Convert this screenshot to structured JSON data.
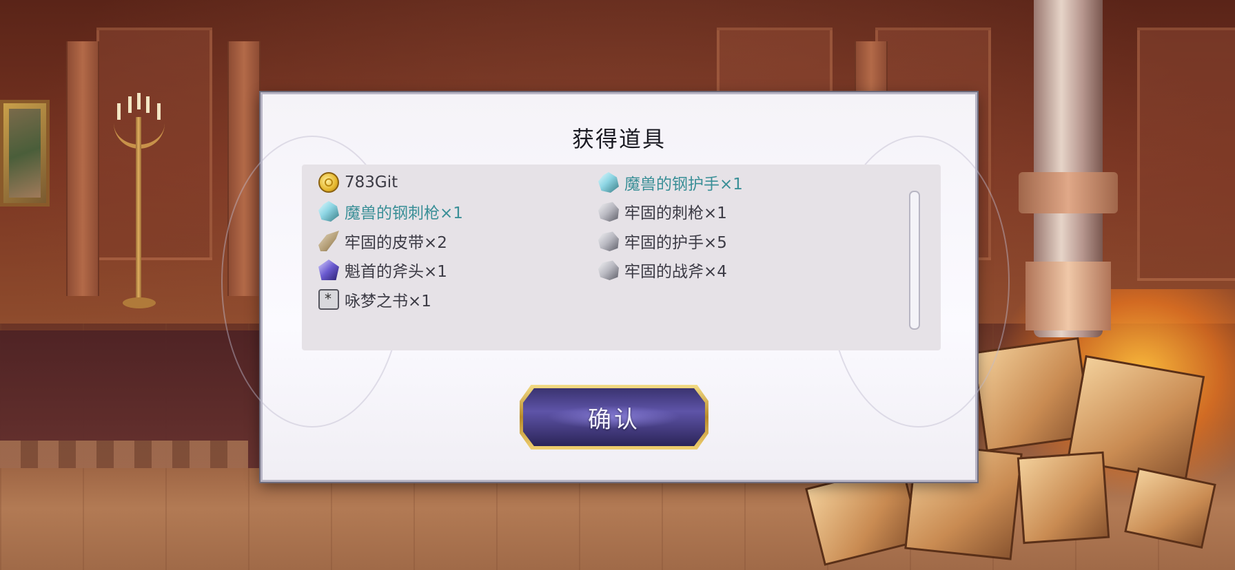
{
  "dialog": {
    "title": "获得道具",
    "confirm_label": "确认"
  },
  "items_left": [
    {
      "label": "783Git",
      "icon": "gold-coin-icon",
      "rare": false
    },
    {
      "label": "魔兽的钢刺枪×1",
      "icon": "crystal-icon",
      "rare": true
    },
    {
      "label": "牢固的皮带×2",
      "icon": "belt-icon",
      "rare": false
    },
    {
      "label": "魁首的斧头×1",
      "icon": "purple-gem-icon",
      "rare": false
    },
    {
      "label": "咏梦之书×1",
      "icon": "book-icon",
      "rare": false
    }
  ],
  "items_right": [
    {
      "label": "魔兽的钢护手×1",
      "icon": "crystal-icon",
      "rare": true
    },
    {
      "label": "牢固的刺枪×1",
      "icon": "ore-icon",
      "rare": false
    },
    {
      "label": "牢固的护手×5",
      "icon": "ore-icon",
      "rare": false
    },
    {
      "label": "牢固的战斧×4",
      "icon": "ore-icon",
      "rare": false
    }
  ],
  "colors": {
    "rare_text": "#3a8f97",
    "normal_text": "#3c3b45",
    "button_fill": "#4a4290",
    "button_border": "#d4b050"
  }
}
